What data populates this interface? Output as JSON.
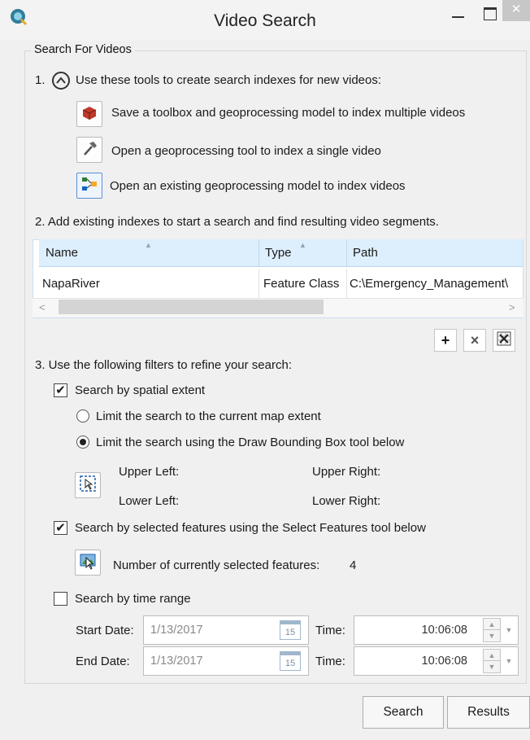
{
  "window": {
    "title": "Video Search",
    "close_glyph": "✕"
  },
  "group": {
    "legend": "Search For Videos"
  },
  "step1": {
    "label": "1.",
    "text": "Use these tools to create search indexes for new videos:",
    "tools": [
      {
        "label": "Save a toolbox and geoprocessing model to index multiple videos",
        "icon": "toolbox-icon"
      },
      {
        "label": "Open a geoprocessing tool to index a single video",
        "icon": "hammer-icon"
      },
      {
        "label": "Open an existing geoprocessing model to index videos",
        "icon": "model-icon"
      }
    ]
  },
  "step2": {
    "text": "2.  Add existing indexes to start a search and find resulting video segments.",
    "columns": [
      "Name",
      "Type",
      "Path"
    ],
    "rows": [
      {
        "name": "NapaRiver",
        "type": "Feature Class",
        "path": "C:\\Emergency_Management\\"
      }
    ],
    "scroll_left": "<",
    "scroll_right": ">",
    "buttons": {
      "add": "+",
      "remove": "×"
    }
  },
  "step3": {
    "text": "3.  Use the following filters to refine your search:",
    "spatial": {
      "label": "Search by spatial extent",
      "checked": true,
      "option_current": "Limit the search to the current map extent",
      "option_draw": "Limit the search using the Draw Bounding Box tool below",
      "upper_left": "Upper Left:",
      "upper_right": "Upper Right:",
      "lower_left": "Lower Left:",
      "lower_right": "Lower Right:"
    },
    "selected": {
      "label": "Search by selected features using the Select Features tool below",
      "checked": true,
      "count_label": "Number of currently selected features:",
      "count": "4"
    },
    "time": {
      "label": "Search by time range",
      "checked": false,
      "start_label": "Start Date:",
      "start_date": "1/13/2017",
      "end_label": "End Date:",
      "end_date": "1/13/2017",
      "time_label": "Time:",
      "start_time": "10:06:08",
      "end_time": "10:06:08",
      "calendar_day": "15"
    }
  },
  "footer": {
    "search": "Search",
    "results": "Results"
  },
  "check_glyph": "✔"
}
